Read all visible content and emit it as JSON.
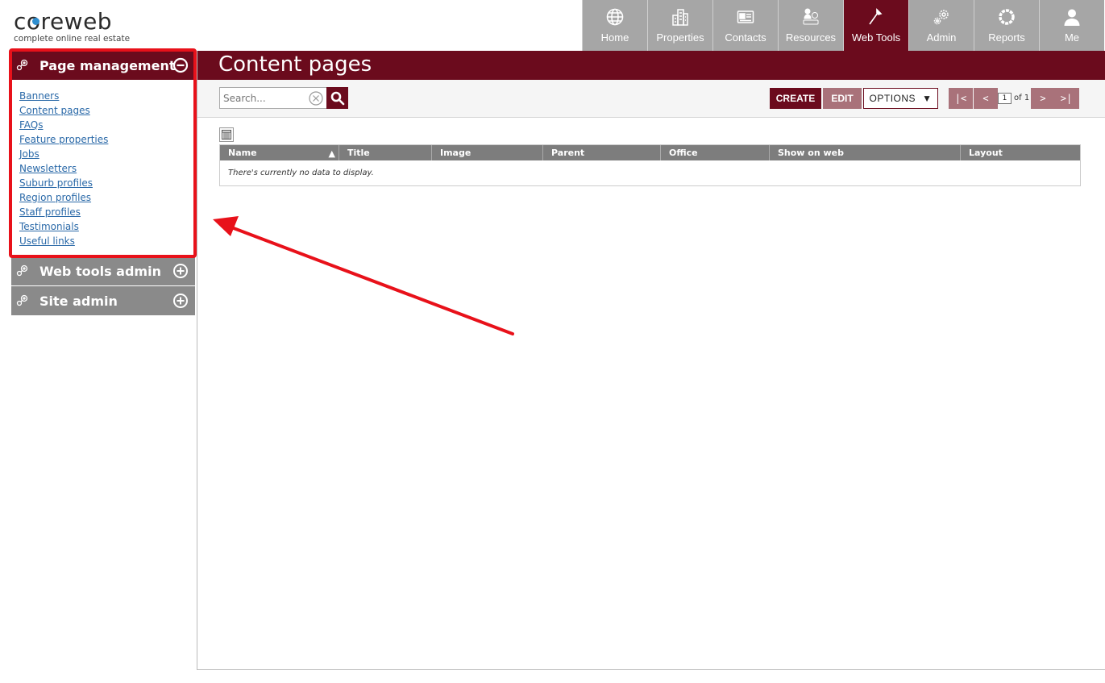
{
  "header": {
    "logo": {
      "word_start": "c",
      "word_rest": "reweb",
      "tagline": "complete online real estate"
    },
    "nav": [
      {
        "label": "Home",
        "icon": "globe-icon",
        "active": false
      },
      {
        "label": "Properties",
        "icon": "buildings-icon",
        "active": false
      },
      {
        "label": "Contacts",
        "icon": "contact-card-icon",
        "active": false
      },
      {
        "label": "Resources",
        "icon": "resources-icon",
        "active": false
      },
      {
        "label": "Web Tools",
        "icon": "hammer-icon",
        "active": true
      },
      {
        "label": "Admin",
        "icon": "gears-icon",
        "active": false
      },
      {
        "label": "Reports",
        "icon": "ring-icon",
        "active": false
      },
      {
        "label": "Me",
        "icon": "user-icon",
        "active": false
      }
    ]
  },
  "sidebar": {
    "page_management": {
      "title": "Page management",
      "links": [
        "Banners",
        "Content pages",
        "FAQs",
        "Feature properties",
        "Jobs",
        "Newsletters",
        "Suburb profiles",
        "Region profiles",
        "Staff profiles",
        "Testimonials",
        "Useful links"
      ]
    },
    "web_tools_admin": {
      "title": "Web tools admin"
    },
    "site_admin": {
      "title": "Site admin"
    }
  },
  "main": {
    "title": "Content pages",
    "search": {
      "placeholder": "Search..."
    },
    "toolbar": {
      "create": "CREATE",
      "edit": "EDIT",
      "options": "OPTIONS"
    },
    "pager": {
      "first": "|<",
      "prev": "<",
      "current": "1",
      "of": "of 1",
      "next": ">",
      "last": ">|"
    },
    "grid": {
      "columns": [
        "Name",
        "Title",
        "Image",
        "Parent",
        "Office",
        "Show on web",
        "Layout"
      ],
      "empty_message": "There's currently no data to display."
    }
  },
  "colors": {
    "brand": "#6b0b1d",
    "nav_inactive": "#a6a6a6",
    "highlight": "#e8111a"
  }
}
